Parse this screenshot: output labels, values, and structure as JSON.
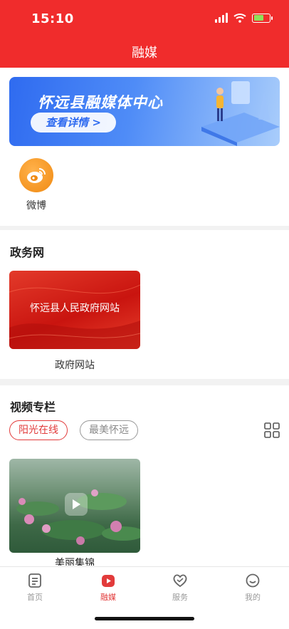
{
  "status_bar": {
    "time": "15:10"
  },
  "header": {
    "title": "融媒"
  },
  "banner": {
    "title": "怀远县融媒体中心",
    "cta": "查看详情 >"
  },
  "weibo": {
    "label": "微博",
    "icon": "weibo-icon"
  },
  "gov_section": {
    "title": "政务网",
    "card_text": "怀远县人民政府网站",
    "caption": "政府网站"
  },
  "video_section": {
    "title": "视频专栏",
    "chips": [
      "阳光在线",
      "最美怀远"
    ],
    "video_caption": "美丽集锦"
  },
  "tabbar": {
    "items": [
      {
        "label": "首页",
        "icon": "document-icon",
        "active": false
      },
      {
        "label": "融媒",
        "icon": "play-icon",
        "active": true
      },
      {
        "label": "服务",
        "icon": "heart-icon",
        "active": false
      },
      {
        "label": "我的",
        "icon": "smile-icon",
        "active": false
      }
    ]
  },
  "colors": {
    "brand_red": "#f02c2c",
    "active_red": "#e23b3b",
    "banner_blue": "#2f6bf0",
    "weibo_orange": "#f08a12"
  }
}
